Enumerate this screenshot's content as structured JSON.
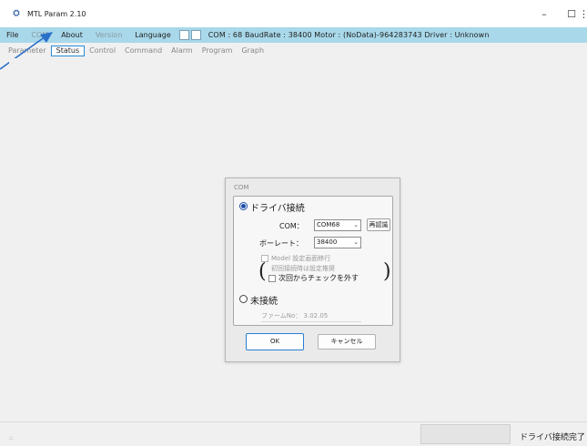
{
  "window": {
    "app_icon_text": "⛭",
    "title": "MTL Param 2.10",
    "minimize_glyph": "–",
    "maximize_glyph": "☐",
    "close_glyph": "⋮"
  },
  "menubar": {
    "items": [
      {
        "label": "File",
        "disabled": false
      },
      {
        "label": "COM",
        "disabled": true
      },
      {
        "label": "About",
        "disabled": false
      },
      {
        "label": "Version",
        "disabled": true
      },
      {
        "label": "Language",
        "disabled": false
      }
    ],
    "status_text": "COM : 68   BaudRate : 38400   Motor : (NoData)-964283743  Driver : Unknown"
  },
  "tabs": [
    {
      "label": "Parameter",
      "active": false
    },
    {
      "label": "Status",
      "active": true
    },
    {
      "label": "Control",
      "active": false
    },
    {
      "label": "Command",
      "active": false
    },
    {
      "label": "Alarm",
      "active": false
    },
    {
      "label": "Program",
      "active": false
    },
    {
      "label": "Graph",
      "active": false
    }
  ],
  "dialog": {
    "title": "COM",
    "driver_connect_label": "ドライバ接続",
    "com_label": "COM：",
    "com_value": "COM68",
    "recognize_button": "再認識",
    "baud_label": "ボーレート：",
    "baud_value": "38400",
    "model_setting_label": "Model 設定画面移行",
    "first_connect_note": "初回接続時は設定推奨",
    "next_time_uncheck_label": "次回からチェックを外す",
    "paren_open": "(",
    "paren_close": ")",
    "no_connect_label": "未接続",
    "firmware_label": "ファームNo：  3.02.05",
    "ok_button": "OK",
    "cancel_button": "キャンセル",
    "dropdown_glyph": "⌄"
  },
  "statusbar": {
    "left_text": "::",
    "right_text": "ドライバ接続完了"
  },
  "colors": {
    "menubar_bg": "#a8d8ea",
    "accent": "#2a7fd4",
    "arrow": "#2a6fc9"
  }
}
